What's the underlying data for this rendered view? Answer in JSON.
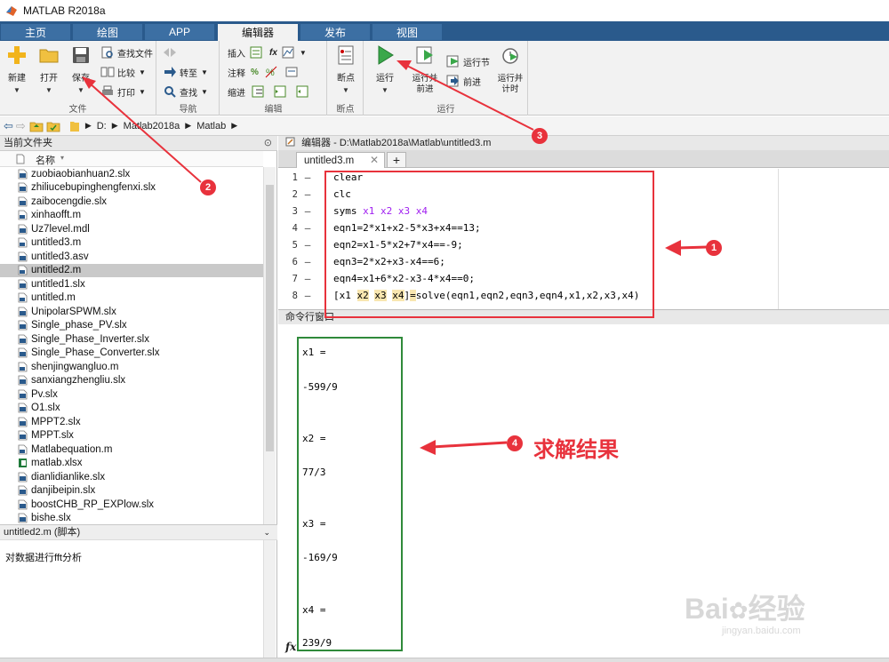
{
  "window": {
    "title": "MATLAB R2018a"
  },
  "tabs": [
    {
      "label": "主页"
    },
    {
      "label": "绘图"
    },
    {
      "label": "APP"
    },
    {
      "label": "编辑器"
    },
    {
      "label": "发布"
    },
    {
      "label": "视图"
    }
  ],
  "ribbon": {
    "file": {
      "group_label": "文件",
      "new_label": "新建",
      "open_label": "打开",
      "save_label": "保存",
      "find_files_label": "查找文件",
      "compare_label": "比较",
      "print_label": "打印"
    },
    "navigate": {
      "group_label": "导航",
      "goto_label": "转至",
      "find_label": "查找"
    },
    "edit": {
      "group_label": "编辑",
      "insert_label": "插入",
      "comment_label": "注释",
      "indent_label": "缩进",
      "fx_glyph": "fx"
    },
    "breakpoints": {
      "group_label": "断点",
      "breakpoints_label": "断点"
    },
    "run": {
      "group_label": "运行",
      "run_label": "运行",
      "run_advance_label": "运行并前进",
      "run_section_label": "运行节",
      "advance_label": "前进",
      "run_and_time_label": "运行并计时"
    }
  },
  "address": {
    "segments": [
      "D:",
      "Matlab2018a",
      "Matlab"
    ]
  },
  "current_folder": {
    "title": "当前文件夹",
    "column_name": "名称",
    "files": [
      {
        "name": "zuobiaobianhuan2.slx",
        "type": "slx"
      },
      {
        "name": "zhiliucebupinghengfenxi.slx",
        "type": "slx"
      },
      {
        "name": "zaibocengdie.slx",
        "type": "slx"
      },
      {
        "name": "xinhaofft.m",
        "type": "m"
      },
      {
        "name": "Uz7level.mdl",
        "type": "mdl"
      },
      {
        "name": "untitled3.m",
        "type": "m"
      },
      {
        "name": "untitled3.asv",
        "type": "asv"
      },
      {
        "name": "untitled2.m",
        "type": "m",
        "selected": true
      },
      {
        "name": "untitled1.slx",
        "type": "slx"
      },
      {
        "name": "untitled.m",
        "type": "m"
      },
      {
        "name": "UnipolarSPWM.slx",
        "type": "slx"
      },
      {
        "name": "Single_phase_PV.slx",
        "type": "slx"
      },
      {
        "name": "Single_Phase_Inverter.slx",
        "type": "slx"
      },
      {
        "name": "Single_Phase_Converter.slx",
        "type": "slx"
      },
      {
        "name": "shenjingwangluo.m",
        "type": "m"
      },
      {
        "name": "sanxiangzhengliu.slx",
        "type": "slx"
      },
      {
        "name": "Pv.slx",
        "type": "slx"
      },
      {
        "name": "O1.slx",
        "type": "slx"
      },
      {
        "name": "MPPT2.slx",
        "type": "slx"
      },
      {
        "name": "MPPT.slx",
        "type": "slx"
      },
      {
        "name": "Matlabequation.m",
        "type": "m"
      },
      {
        "name": "matlab.xlsx",
        "type": "xlsx"
      },
      {
        "name": "dianlidianlike.slx",
        "type": "slx"
      },
      {
        "name": "danjibeipin.slx",
        "type": "slx"
      },
      {
        "name": "boostCHB_RP_EXPlow.slx",
        "type": "slx"
      },
      {
        "name": "bishe.slx",
        "type": "slx"
      }
    ],
    "details_title": "untitled2.m  (脚本)",
    "details_text": "对数据进行fft分析"
  },
  "editor": {
    "header": "编辑器 - D:\\Matlab2018a\\Matlab\\untitled3.m",
    "tab_label": "untitled3.m",
    "tab_close": "✕",
    "add_tab": "+",
    "lines": [
      {
        "num": "1",
        "dash": "—"
      },
      {
        "num": "2",
        "dash": "—"
      },
      {
        "num": "3",
        "dash": "—"
      },
      {
        "num": "4",
        "dash": "—"
      },
      {
        "num": "5",
        "dash": "—"
      },
      {
        "num": "6",
        "dash": "—"
      },
      {
        "num": "7",
        "dash": "—"
      },
      {
        "num": "8",
        "dash": "—"
      }
    ],
    "code": {
      "l1": "clear",
      "l2": "clc",
      "l3_kw": "syms",
      "l3_args": " x1 x2 x3 x4",
      "l4": "eqn1=2*x1+x2-5*x3+x4==13;",
      "l5": "eqn2=x1-5*x2+7*x4==-9;",
      "l6": "eqn3=2*x2+x3-x4==6;",
      "l7": "eqn4=x1+6*x2-x3-4*x4==0;",
      "l8_open": "[x1 ",
      "l8_x2": "x2",
      "l8_sp1": " ",
      "l8_x3": "x3",
      "l8_sp2": " ",
      "l8_x4": "x4",
      "l8_close": "]",
      "l8_eq": "=",
      "l8_rest": "solve(eqn1,eqn2,eqn3,eqn4,x1,x2,x3,x4)"
    }
  },
  "command_window": {
    "title": "命令行窗口",
    "outputs": [
      {
        "label": "x1 =",
        "value": "-599/9"
      },
      {
        "label": "x2 =",
        "value": "77/3"
      },
      {
        "label": "x3 =",
        "value": "-169/9"
      },
      {
        "label": "x4 =",
        "value": "239/9"
      }
    ],
    "prompt_glyph": "fx"
  },
  "annotations": {
    "badge1": "1",
    "badge2": "2",
    "badge3": "3",
    "badge4": "4",
    "note4": "求解结果",
    "colors": {
      "red": "#e8323c",
      "green": "#2f8a3a",
      "blue": "#2a5a8c"
    }
  },
  "watermark": {
    "brand": "Bai",
    "brand2": "经验",
    "url": "jingyan.baidu.com"
  }
}
